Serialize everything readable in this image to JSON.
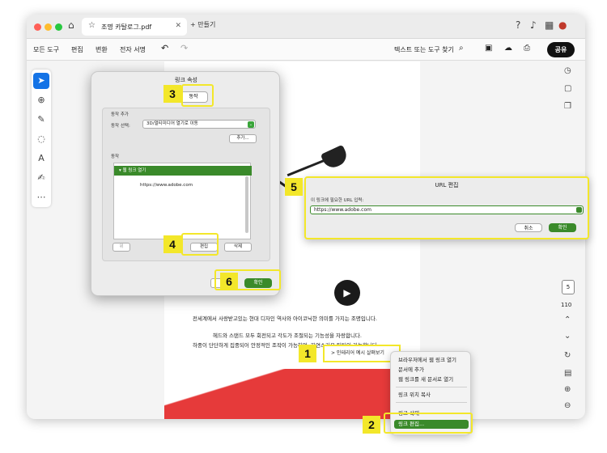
{
  "tab": {
    "title": "조명 카탈로그.pdf",
    "new_tab": "+ 만들기"
  },
  "menubar": {
    "items": [
      "모든 도구",
      "편집",
      "변환",
      "전자 서명"
    ],
    "find": "텍스트 또는 도구 찾기",
    "share": "공유"
  },
  "document": {
    "line1": "전세계에서 사랑받고있는 현대 디자인 역사와 아이코닉한 의미를 가지는 조명입니다.",
    "line2": "헤드와 스탠드 모두 회전되고 각도가 조절되는 기능성을 자랑합니다.",
    "line3": "하중이 단단하게 집중되어 안정적인 조작이 가능하며, 자연스러운 틸팅이 가능합니다.",
    "link_text": "> 인테리어 예시 살펴보기",
    "page_current": "5",
    "page_total": "110"
  },
  "link_dialog": {
    "title": "링크 속성",
    "tab": "동작",
    "add_action_label": "동작 추가",
    "select_action_label": "동작 선택:",
    "select_action_value": "3D/멀티미디어 열기로 이동",
    "add_button": "추가...",
    "actions_label": "동작",
    "list_selected": "웹 링크 열기",
    "list_url": "https://www.adobe.com",
    "up_button": "위",
    "edit_button": "편집",
    "delete_button": "삭제",
    "ok_button": "확인"
  },
  "url_dialog": {
    "title": "URL 편집",
    "prompt": "이 링크에 필요한 URL 입력:",
    "value": "https://www.adobe.com",
    "cancel": "취소",
    "ok": "확인"
  },
  "context_menu": {
    "items": [
      "브라우저에서 웹 링크 열기",
      "문서에 추가",
      "웹 링크를 새 문서로 열기",
      "링크 위치 복사",
      "링크 삭제",
      "링크 편집..."
    ]
  },
  "steps": [
    "1",
    "2",
    "3",
    "4",
    "5",
    "6"
  ],
  "colors": {
    "highlight": "#f3e72a",
    "green": "#3a8a2a",
    "red": "#e63a3a",
    "share_bg": "#111111"
  }
}
